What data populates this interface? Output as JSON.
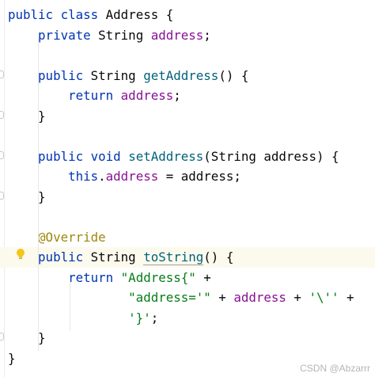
{
  "editor": {
    "lines": [
      [
        {
          "t": "public ",
          "c": "kw"
        },
        {
          "t": "class ",
          "c": "kw"
        },
        {
          "t": "Address {",
          "c": "plain"
        }
      ],
      [
        {
          "t": "    ",
          "c": "plain"
        },
        {
          "t": "private ",
          "c": "kw"
        },
        {
          "t": "String ",
          "c": "plain"
        },
        {
          "t": "address",
          "c": "fld"
        },
        {
          "t": ";",
          "c": "plain"
        }
      ],
      [],
      [
        {
          "t": "    ",
          "c": "plain"
        },
        {
          "t": "public ",
          "c": "kw"
        },
        {
          "t": "String ",
          "c": "plain"
        },
        {
          "t": "getAddress",
          "c": "fn"
        },
        {
          "t": "() {",
          "c": "plain"
        }
      ],
      [
        {
          "t": "        ",
          "c": "plain"
        },
        {
          "t": "return ",
          "c": "kw"
        },
        {
          "t": "address",
          "c": "fld"
        },
        {
          "t": ";",
          "c": "plain"
        }
      ],
      [
        {
          "t": "    }",
          "c": "plain"
        }
      ],
      [],
      [
        {
          "t": "    ",
          "c": "plain"
        },
        {
          "t": "public ",
          "c": "kw"
        },
        {
          "t": "void ",
          "c": "kw"
        },
        {
          "t": "setAddress",
          "c": "fn"
        },
        {
          "t": "(String address) {",
          "c": "plain"
        }
      ],
      [
        {
          "t": "        ",
          "c": "plain"
        },
        {
          "t": "this",
          "c": "kw"
        },
        {
          "t": ".",
          "c": "plain"
        },
        {
          "t": "address",
          "c": "fld"
        },
        {
          "t": " = address;",
          "c": "plain"
        }
      ],
      [
        {
          "t": "    }",
          "c": "plain"
        }
      ],
      [],
      [
        {
          "t": "    ",
          "c": "plain"
        },
        {
          "t": "@Override",
          "c": "ann"
        }
      ],
      [
        {
          "t": "    ",
          "c": "plain"
        },
        {
          "t": "public ",
          "c": "kw"
        },
        {
          "t": "String ",
          "c": "plain"
        },
        {
          "t": "toString",
          "c": "fn u"
        },
        {
          "t": "() {",
          "c": "plain"
        }
      ],
      [
        {
          "t": "        ",
          "c": "plain"
        },
        {
          "t": "return ",
          "c": "kw"
        },
        {
          "t": "\"Address{\"",
          "c": "str"
        },
        {
          "t": " +",
          "c": "plain"
        }
      ],
      [
        {
          "t": "                ",
          "c": "plain"
        },
        {
          "t": "\"address='\"",
          "c": "str"
        },
        {
          "t": " + ",
          "c": "plain"
        },
        {
          "t": "address",
          "c": "fld"
        },
        {
          "t": " + ",
          "c": "plain"
        },
        {
          "t": "'\\''",
          "c": "str"
        },
        {
          "t": " +",
          "c": "plain"
        }
      ],
      [
        {
          "t": "                ",
          "c": "plain"
        },
        {
          "t": "'}'",
          "c": "str"
        },
        {
          "t": ";",
          "c": "plain"
        }
      ],
      [
        {
          "t": "    }",
          "c": "plain"
        }
      ],
      [
        {
          "t": "}",
          "c": "plain"
        }
      ]
    ],
    "highlighted_line": 12,
    "intention_icon": "lightbulb-icon"
  },
  "watermark": "CSDN @Abzarrr"
}
